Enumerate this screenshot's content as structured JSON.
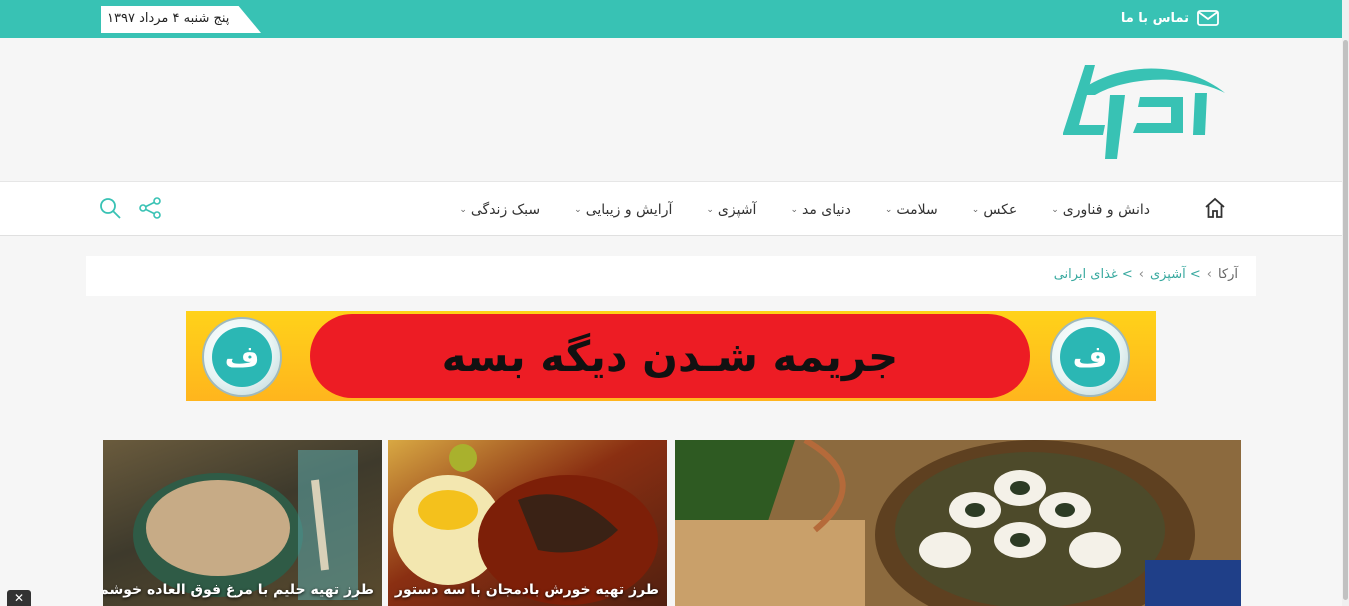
{
  "topbar": {
    "date": "پنج شنبه ۴ مرداد ۱۳۹۷",
    "contact_label": "تماس با ما"
  },
  "nav": {
    "items": [
      {
        "label": "سبک زندگی",
        "has_dropdown": true
      },
      {
        "label": "آرایش و زیبایی",
        "has_dropdown": true
      },
      {
        "label": "آشپزی",
        "has_dropdown": true
      },
      {
        "label": "دنیای مد",
        "has_dropdown": true
      },
      {
        "label": "سلامت",
        "has_dropdown": true
      },
      {
        "label": "عکس",
        "has_dropdown": true
      },
      {
        "label": "دانش و فناوری",
        "has_dropdown": true
      }
    ]
  },
  "breadcrumb": {
    "home": "آرکا",
    "sep1": "›",
    "link1": "> آشپزی",
    "sep2": "›",
    "link2": "> غذای ایرانی"
  },
  "banner": {
    "text": "جریمه شـدن دیگه بسه",
    "badge_glyph": "ف"
  },
  "cards": [
    {
      "title": "طرز تهیه حلیم با مرغ فوق العاده خوشمزه"
    },
    {
      "title": "طرز تهیه خورش بادمجان با سه دستور"
    },
    {
      "title": ""
    }
  ],
  "colors": {
    "accent": "#38c2b4",
    "banner_red": "#ed1c24",
    "banner_yellow": "#ffc61e"
  },
  "close_glyph": "✕"
}
